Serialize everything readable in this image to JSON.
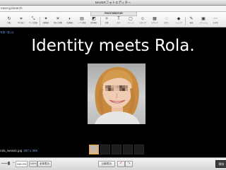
{
  "window": {
    "title": "NAVERフォトエディター"
  },
  "address": {
    "url": "naver.jp/search"
  },
  "toolbar": {
    "brand": "PHOTOEDITOR",
    "tools": [
      {
        "label": "回転",
        "icon": "rotate-icon"
      },
      {
        "label": "切り抜き",
        "icon": "crop-icon"
      },
      {
        "label": "サイズ変更",
        "icon": "resize-icon"
      },
      {
        "label": "自動補正",
        "icon": "auto-fix-icon"
      },
      {
        "label": "明るさ調整",
        "icon": "brightness-icon"
      },
      {
        "label": "色調補正",
        "icon": "color-icon"
      },
      {
        "label": "レベル補正",
        "icon": "levels-icon"
      },
      {
        "label": "部分補正",
        "icon": "partial-fix-icon"
      },
      {
        "label": "効果",
        "icon": "effect-icon"
      },
      {
        "label": "文字",
        "icon": "text-icon"
      },
      {
        "label": "フレーム",
        "icon": "frame-icon"
      },
      {
        "label": "スタンプ",
        "icon": "stamp-icon"
      },
      {
        "label": "モザイク",
        "icon": "mosaic-icon"
      },
      {
        "label": "ぼかし",
        "icon": "blur-icon"
      },
      {
        "label": "シャープ",
        "icon": "sharpen-icon"
      },
      {
        "label": "描画",
        "icon": "draw-icon"
      },
      {
        "label": "コラージュ",
        "icon": "collage-icon"
      },
      {
        "label": "その他",
        "icon": "more-icon"
      }
    ]
  },
  "canvas": {
    "side_label": "写真一覧 (1)",
    "headline": "Identity meets Rola.",
    "file_name": "rola_iwasa1.jpg",
    "file_size": "287 x 365"
  },
  "bottombar": {
    "zoom_level": "100.0%",
    "btn_100": "100%",
    "btn_fit": "全体表示",
    "btn_compare": "比較表示",
    "btn_undo": "↶",
    "btn_redo": "↷",
    "btn_save": "保存"
  },
  "colors": {
    "thumb_active_border": "#f0a030",
    "file_size_text": "#7aa7e0",
    "side_label_text": "#6aa8ff"
  }
}
